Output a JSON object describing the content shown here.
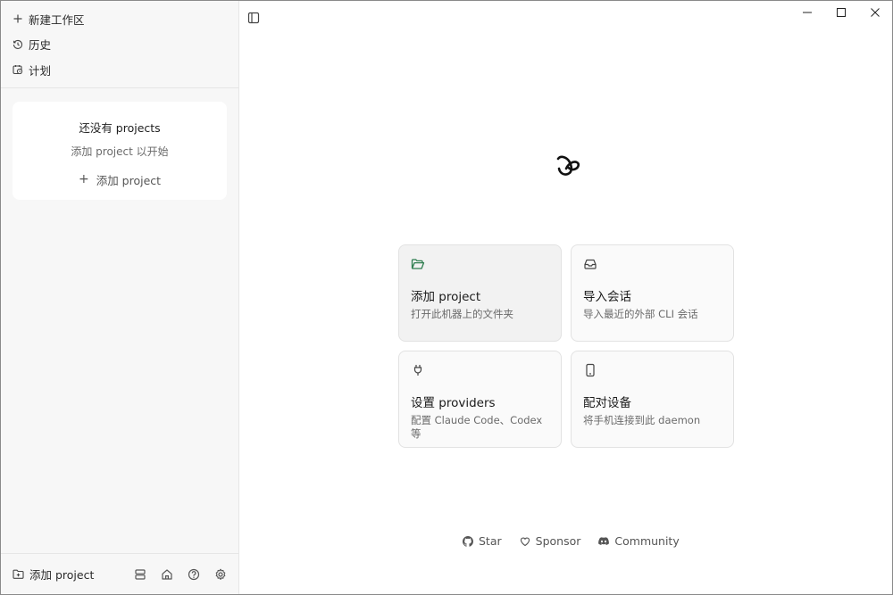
{
  "sidebar": {
    "nav": [
      {
        "label": "新建工作区",
        "icon": "plus-icon"
      },
      {
        "label": "历史",
        "icon": "history-icon"
      },
      {
        "label": "计划",
        "icon": "calendar-clock-icon"
      }
    ],
    "empty": {
      "title": "还没有 projects",
      "subtitle": "添加 project 以开始",
      "add_label": "添加 project"
    },
    "footer": {
      "add_label": "添加 project",
      "icons": [
        "layout-rows-icon",
        "home-icon",
        "help-icon",
        "settings-icon"
      ]
    }
  },
  "main": {
    "cards": [
      {
        "title": "添加 project",
        "desc": "打开此机器上的文件夹",
        "icon": "folder-open-icon"
      },
      {
        "title": "导入会话",
        "desc": "导入最近的外部 CLI 会话",
        "icon": "inbox-icon"
      },
      {
        "title": "设置 providers",
        "desc": "配置 Claude Code、Codex 等",
        "icon": "plug-icon"
      },
      {
        "title": "配对设备",
        "desc": "将手机连接到此 daemon",
        "icon": "phone-icon"
      }
    ],
    "links": [
      {
        "label": "Star",
        "icon": "github-icon"
      },
      {
        "label": "Sponsor",
        "icon": "heart-icon"
      },
      {
        "label": "Community",
        "icon": "discord-icon"
      }
    ]
  },
  "colors": {
    "accent_green": "#2e7d4f",
    "sidebar_bg": "#f7f7f7",
    "card_border": "#e2e2e2"
  }
}
